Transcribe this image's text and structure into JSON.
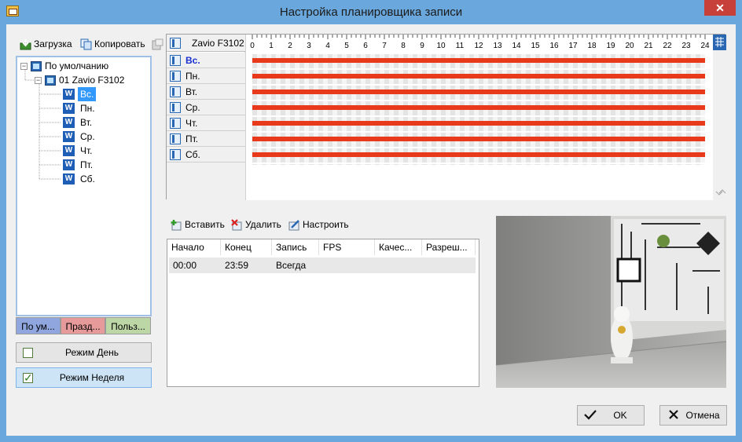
{
  "window": {
    "title": "Настройка планировщика записи",
    "close_glyph": "✕"
  },
  "toolbar_left": {
    "load_label": "Загрузка",
    "copy_label": "Копировать"
  },
  "tree": {
    "root_label": "По умолчанию",
    "camera_label": "01 Zavio F3102",
    "days": [
      {
        "icon": "W",
        "label": "Вс."
      },
      {
        "icon": "W",
        "label": "Пн."
      },
      {
        "icon": "W",
        "label": "Вт."
      },
      {
        "icon": "W",
        "label": "Ср."
      },
      {
        "icon": "W",
        "label": "Чт."
      },
      {
        "icon": "W",
        "label": "Пт."
      },
      {
        "icon": "W",
        "label": "Сб."
      }
    ]
  },
  "tabs": [
    {
      "label": "По ум...",
      "color": "#8fa6df"
    },
    {
      "label": "Празд...",
      "color": "#e79a9a"
    },
    {
      "label": "Польз...",
      "color": "#bcd6a5"
    }
  ],
  "modes": {
    "day_label": "Режим День",
    "week_label": "Режим Неделя",
    "day_checked": false,
    "week_checked": true
  },
  "grid": {
    "camera_label": "Zavio F3102",
    "hours": [
      "0",
      "1",
      "2",
      "3",
      "4",
      "5",
      "6",
      "7",
      "8",
      "9",
      "10",
      "11",
      "12",
      "13",
      "14",
      "15",
      "16",
      "17",
      "18",
      "19",
      "20",
      "21",
      "22",
      "23",
      "24"
    ],
    "rows": [
      {
        "label": "Вс.",
        "start": 0,
        "end": 24,
        "selected": true
      },
      {
        "label": "Пн.",
        "start": 0,
        "end": 24,
        "selected": false
      },
      {
        "label": "Вт.",
        "start": 0,
        "end": 24,
        "selected": false
      },
      {
        "label": "Ср.",
        "start": 0,
        "end": 24,
        "selected": false
      },
      {
        "label": "Чт.",
        "start": 0,
        "end": 24,
        "selected": false
      },
      {
        "label": "Пт.",
        "start": 0,
        "end": 24,
        "selected": false
      },
      {
        "label": "Сб.",
        "start": 0,
        "end": 24,
        "selected": false
      }
    ],
    "bar_color": "#e8391a",
    "selected_color": "#1a2fd0"
  },
  "list_toolbar": {
    "insert_label": "Вставить",
    "delete_label": "Удалить",
    "setup_label": "Настроить"
  },
  "list": {
    "columns": [
      "Начало",
      "Конец",
      "Запись",
      "FPS",
      "Качес...",
      "Разреш..."
    ],
    "rows": [
      [
        "00:00",
        "23:59",
        "Всегда",
        "",
        "",
        ""
      ]
    ]
  },
  "buttons": {
    "ok_label": "OK",
    "cancel_label": "Отмена"
  }
}
